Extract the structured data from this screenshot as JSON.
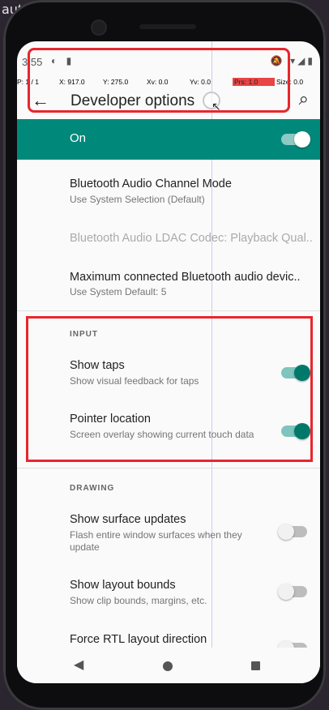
{
  "background_text": "aut",
  "status_bar": {
    "time": "3:55",
    "left_icons": "◐ ▮",
    "right_icons": "🔕 ▾◢▮"
  },
  "pointer_info": {
    "p": "P: 1 / 1",
    "x": "X: 917.0",
    "y": "Y: 275.0",
    "xv": "Xv: 0.0",
    "yv": "Yv: 0.0",
    "prs": "Prs: 1.0",
    "size": "Size: 0.0"
  },
  "app_bar": {
    "title": "Developer options",
    "back_icon": "←",
    "search_icon": "⌕"
  },
  "master_switch": {
    "label": "On",
    "state": true
  },
  "items": [
    {
      "title": "Bluetooth Audio Channel Mode",
      "subtitle": "Use System Selection (Default)"
    },
    {
      "title": "Bluetooth Audio LDAC Codec: Playback Qual..",
      "disabled": true
    },
    {
      "title": "Maximum connected Bluetooth audio devic..",
      "subtitle": "Use System Default: 5"
    }
  ],
  "input_section": {
    "header": "INPUT",
    "items": [
      {
        "title": "Show taps",
        "subtitle": "Show visual feedback for taps",
        "state": true
      },
      {
        "title": "Pointer location",
        "subtitle": "Screen overlay showing current touch data",
        "state": true
      }
    ]
  },
  "drawing_section": {
    "header": "DRAWING",
    "items": [
      {
        "title": "Show surface updates",
        "subtitle": "Flash entire window surfaces when they update",
        "state": false
      },
      {
        "title": "Show layout bounds",
        "subtitle": "Show clip bounds, margins, etc.",
        "state": false
      },
      {
        "title": "Force RTL layout direction",
        "subtitle": "",
        "state": false
      }
    ]
  },
  "nav_bar": {
    "back": "◀"
  },
  "colors": {
    "teal": "#00897b",
    "highlight": "#e8262d"
  }
}
